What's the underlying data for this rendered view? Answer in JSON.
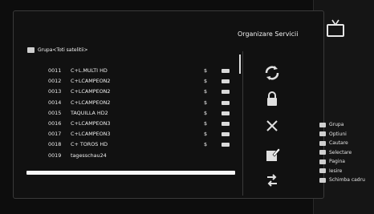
{
  "header": {
    "title": "Organizare Servicii",
    "tv_icon": "tv-icon"
  },
  "group": {
    "label": "Grupa<Toti satelitii>"
  },
  "channels": [
    {
      "num": "0011",
      "name": "C+L.MULTI HD",
      "dollar": "$"
    },
    {
      "num": "0012",
      "name": "C+LCAMPEON2",
      "dollar": "$"
    },
    {
      "num": "0013",
      "name": "C+LCAMPEON2",
      "dollar": "$"
    },
    {
      "num": "0014",
      "name": "C+LCAMPEON2",
      "dollar": "$"
    },
    {
      "num": "0015",
      "name": "TAQUILLA HD2",
      "dollar": "$"
    },
    {
      "num": "0016",
      "name": "C+LCAMPEON3",
      "dollar": "$"
    },
    {
      "num": "0017",
      "name": "C+LCAMPEON3",
      "dollar": "$"
    },
    {
      "num": "0018",
      "name": "C+ TOROS HD",
      "dollar": "$"
    },
    {
      "num": "0019",
      "name": "tagesschau24",
      "dollar": ""
    }
  ],
  "side_actions": [
    {
      "name": "move-icon"
    },
    {
      "name": "lock-icon"
    },
    {
      "name": "delete-icon"
    },
    {
      "name": "rename-icon"
    },
    {
      "name": "sort-icon"
    }
  ],
  "legend": [
    {
      "label": "Grupa"
    },
    {
      "label": "Optiuni"
    },
    {
      "label": "Cautare"
    },
    {
      "label": "Selectare"
    },
    {
      "label": "Pagina"
    },
    {
      "label": "Iesire"
    },
    {
      "label": "Schimba cadru"
    }
  ]
}
